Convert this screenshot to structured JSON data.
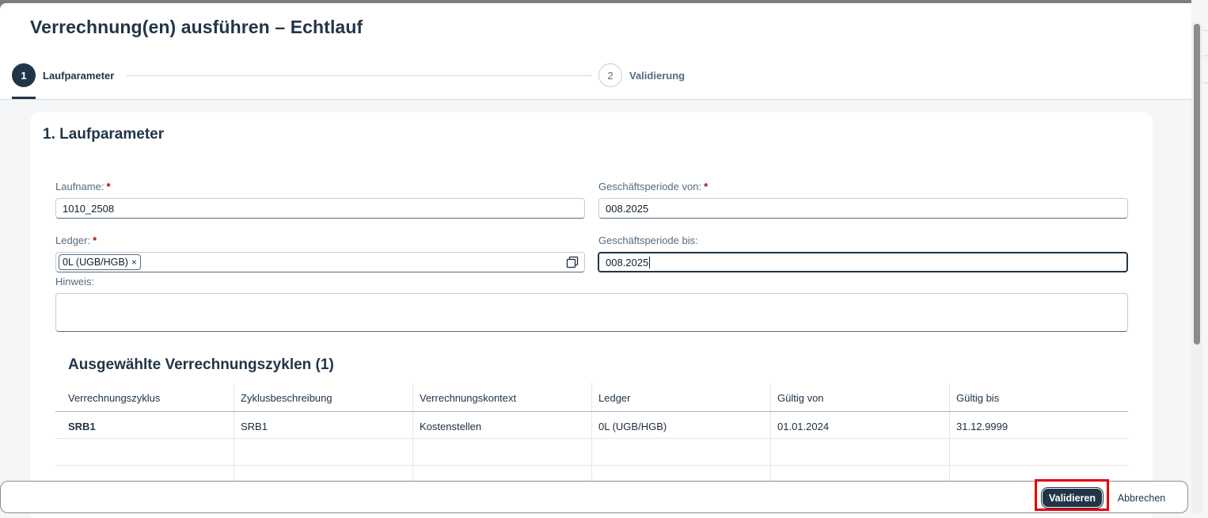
{
  "dialog": {
    "title": "Verrechnung(en) ausführen – Echtlauf"
  },
  "steps": [
    {
      "number": "1",
      "label": "Laufparameter",
      "active": true
    },
    {
      "number": "2",
      "label": "Validierung",
      "active": false
    }
  ],
  "section": {
    "title": "1. Laufparameter"
  },
  "form": {
    "run_name": {
      "label": "Laufname:",
      "required_mark": "*",
      "value": "1010_2508"
    },
    "period_from": {
      "label": "Geschäftsperiode von:",
      "required_mark": "*",
      "value": "008.2025"
    },
    "ledger": {
      "label": "Ledger:",
      "required_mark": "*",
      "token": "0L (UGB/HGB)",
      "token_remove": "×"
    },
    "period_to": {
      "label": "Geschäftsperiode bis:",
      "value": "008.2025"
    },
    "note": {
      "label": "Hinweis:",
      "value": ""
    }
  },
  "table": {
    "title": "Ausgewählte Verrechnungszyklen (1)",
    "columns": [
      "Verrechnungszyklus",
      "Zyklusbeschreibung",
      "Verrechnungskontext",
      "Ledger",
      "Gültig von",
      "Gültig bis"
    ],
    "rows": [
      [
        "SRB1",
        "SRB1",
        "Kostenstellen",
        "0L (UGB/HGB)",
        "01.01.2024",
        "31.12.9999"
      ]
    ]
  },
  "footer": {
    "validate_label": "Validieren",
    "cancel_label": "Abbrechen"
  },
  "colors": {
    "brand": "#223548",
    "required": "#aa0808",
    "highlight": "#e5000b"
  },
  "icons": {
    "value_help": "value-help-icon",
    "token_remove": "close-icon"
  }
}
